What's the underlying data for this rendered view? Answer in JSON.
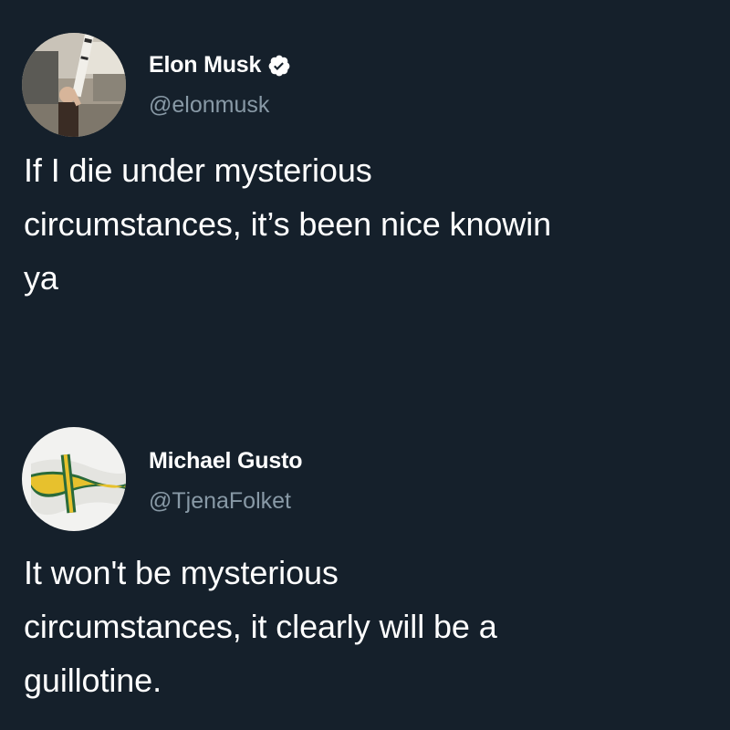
{
  "tweets": [
    {
      "display_name": "Elon Musk",
      "handle": "@elonmusk",
      "verified": true,
      "verified_badge_icon": "verified-check-icon",
      "avatar_description_icon": "profile-photo-icon",
      "text": "If I die under mysterious\ncircumstances, it’s been nice knowin\nya"
    },
    {
      "display_name": "Michael Gusto",
      "handle": "@TjenaFolket",
      "verified": false,
      "avatar_description_icon": "flag-photo-icon",
      "text": "It won't be mysterious\ncircumstances, it clearly will be a\nguillotine."
    }
  ],
  "colors": {
    "background": "#15202b",
    "primary_text": "#ffffff",
    "secondary_text": "#8899a6",
    "verified_badge": "#ffffff"
  }
}
